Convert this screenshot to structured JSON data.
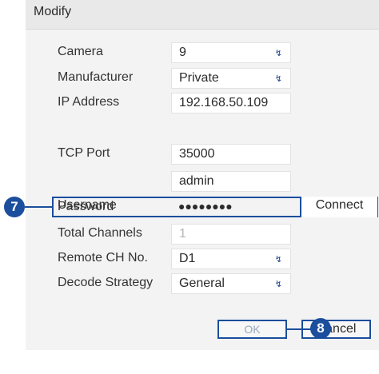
{
  "dialog": {
    "title": "Modify",
    "fields": [
      {
        "label": "Camera",
        "value": "9",
        "dropdown": true
      },
      {
        "label": "Manufacturer",
        "value": "Private",
        "dropdown": true
      },
      {
        "label": "IP Address",
        "value": "192.168.50.109"
      },
      {
        "label": "TCP Port",
        "value": "35000"
      },
      {
        "label": "Username",
        "value": "admin"
      },
      {
        "label": "Password",
        "value": "●●●●●●●●"
      },
      {
        "label": "Total Channels",
        "value": "1",
        "disabled": true
      },
      {
        "label": "Remote CH No.",
        "value": "D1",
        "dropdown": true
      },
      {
        "label": "Decode Strategy",
        "value": "General",
        "dropdown": true
      }
    ],
    "connect_label": "Connect",
    "ok_label": "OK",
    "cancel_label": "Cancel",
    "dropdown_icon": "chevron-down-icon"
  },
  "callouts": {
    "password_step": "7",
    "ok_step": "8"
  },
  "colors": {
    "accent": "#1b4e9c",
    "dialog_bg": "#f3f3f4",
    "title_bg": "#e9e9ea"
  }
}
